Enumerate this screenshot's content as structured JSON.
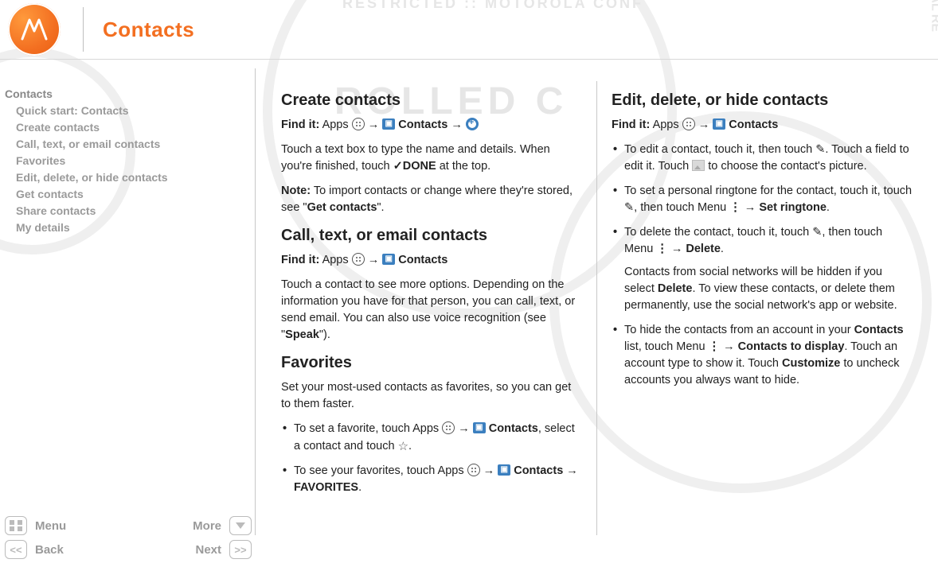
{
  "header": {
    "title": "Contacts"
  },
  "sidebar": {
    "items": [
      {
        "label": "Contacts",
        "indent": false
      },
      {
        "label": "Quick start: Contacts",
        "indent": true
      },
      {
        "label": "Create contacts",
        "indent": true
      },
      {
        "label": "Call, text, or email contacts",
        "indent": true
      },
      {
        "label": "Favorites",
        "indent": true
      },
      {
        "label": "Edit, delete, or hide contacts",
        "indent": true
      },
      {
        "label": "Get contacts",
        "indent": true
      },
      {
        "label": "Share contacts",
        "indent": true
      },
      {
        "label": "My details",
        "indent": true
      }
    ]
  },
  "footer": {
    "menu": "Menu",
    "more": "More",
    "back": "Back",
    "next": "Next"
  },
  "left": {
    "create": {
      "h": "Create contacts",
      "find_prefix": "Find it:",
      "apps": "Apps",
      "contacts": "Contacts",
      "p1a": "Touch a text box to type the name and details. When you're finished, touch ",
      "done": "DONE",
      "p1b": " at the top.",
      "note_prefix": "Note:",
      "note_a": " To import contacts or change where they're stored, see \"",
      "note_link": "Get contacts",
      "note_b": "\"."
    },
    "call": {
      "h": "Call, text, or email contacts",
      "find_prefix": "Find it:",
      "apps": "Apps",
      "contacts": "Contacts",
      "p": "Touch a contact to see more options. Depending on the information you have for that person, you can call, text, or send email. You can also use voice recognition (see \"",
      "speak": "Speak",
      "p_end": "\")."
    },
    "fav": {
      "h": "Favorites",
      "p": "Set your most-used contacts as favorites, so you can get to them faster.",
      "b1a": "To set a favorite, touch Apps ",
      "contacts": "Contacts",
      "b1b": ", select a contact and touch ",
      "b2a": "To see your favorites, touch Apps ",
      "b2b_arrow": "→",
      "favorites": "FAVORITES",
      "period": "."
    }
  },
  "right": {
    "h": "Edit, delete, or hide contacts",
    "find_prefix": "Find it:",
    "apps": "Apps",
    "contacts": "Contacts",
    "b1a": "To edit a contact, touch it, then touch ",
    "b1b": ". Touch a field to edit it. Touch ",
    "b1c": " to choose the contact's picture.",
    "b2a": "To set a personal ringtone for the contact, touch it, touch ",
    "b2b": ", then touch Menu ",
    "b2c": " → ",
    "set_ringtone": "Set ringtone",
    "b3a": "To delete the contact, touch it, touch ",
    "b3b": ", then touch Menu ",
    "b3c": " → ",
    "delete": "Delete",
    "b3_p2a": "Contacts from social networks will be hidden if you select ",
    "b3_p2b": ". To view these contacts, or delete them permanently, use the social network's app or website.",
    "b4a": "To hide the contacts from an account in your ",
    "contacts_bold": "Contacts",
    "b4b": " list, touch Menu ",
    "b4c": " → ",
    "ctd": "Contacts to display",
    "b4d": ". Touch an account type to show it. Touch ",
    "customize": "Customize",
    "b4e": " to uncheck accounts you always want to hide."
  }
}
